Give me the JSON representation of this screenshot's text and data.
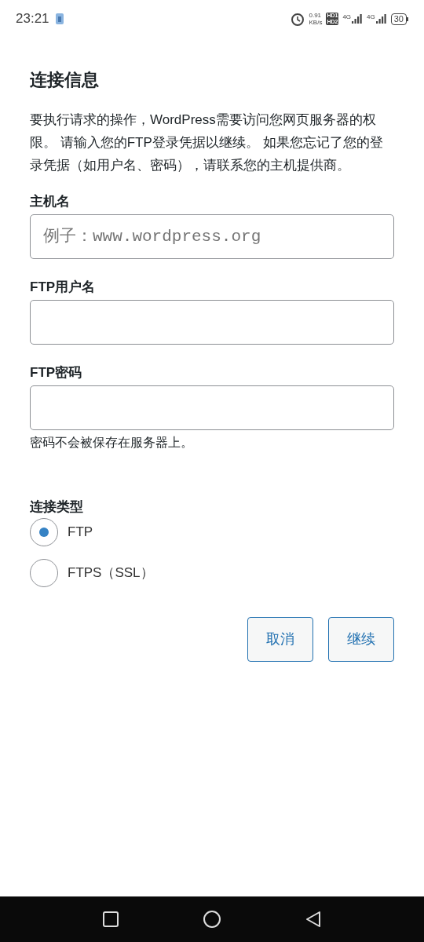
{
  "status_bar": {
    "time": "23:21",
    "speed_value": "0.91",
    "speed_unit": "KB/s",
    "hd_top": "HD1",
    "hd_bottom": "HD2",
    "networks": [
      "4G",
      "4G"
    ],
    "battery": "30"
  },
  "title": "连接信息",
  "intro": "要执行请求的操作，WordPress需要访问您网页服务器的权限。 请输入您的FTP登录凭据以继续。 如果您忘记了您的登录凭据（如用户名、密码），请联系您的主机提供商。",
  "fields": [
    {
      "label": "主机名",
      "placeholder": "例子：www.wordpress.org"
    },
    {
      "label": "FTP用户名"
    },
    {
      "label": "FTP密码",
      "hint": "密码不会被保存在服务器上。"
    }
  ],
  "connection_type": {
    "label": "连接类型",
    "options": [
      {
        "label": "FTP",
        "selected": true
      },
      {
        "label": "FTPS（SSL）",
        "selected": false
      }
    ]
  },
  "buttons": [
    "取消",
    "继续"
  ]
}
